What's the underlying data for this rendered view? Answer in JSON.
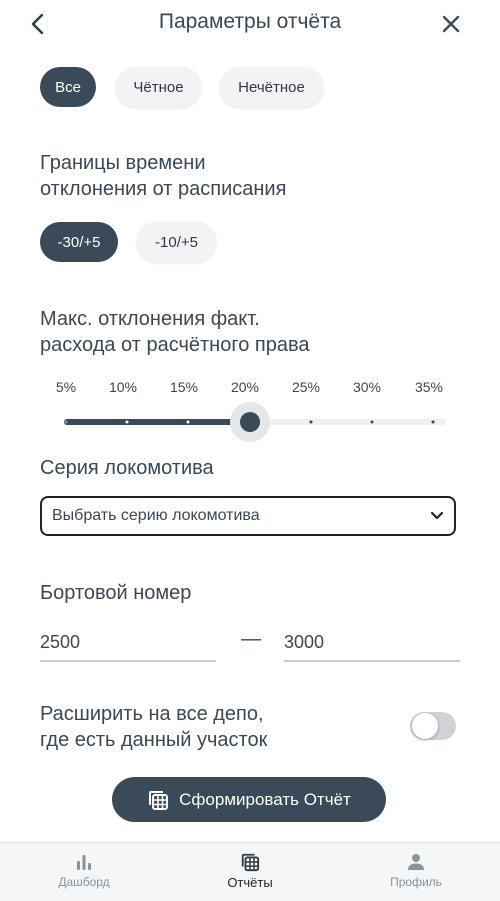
{
  "header": {
    "title": "Параметры отчёта"
  },
  "parity_filter": {
    "options": [
      "Все",
      "Чётное",
      "Нечётное"
    ],
    "selected": "Все"
  },
  "deviation_time": {
    "title_line1": "Границы времени",
    "title_line2": "отклонения от расписания",
    "options": [
      "-30/+5",
      "-10/+5"
    ],
    "selected": "-30/+5"
  },
  "max_deviation": {
    "title_line1": "Макс. отклонения факт.",
    "title_line2": "расхода от расчётного права",
    "ticks": [
      "5%",
      "10%",
      "15%",
      "20%",
      "25%",
      "30%",
      "35%"
    ],
    "selected_value": "20%"
  },
  "loco_series": {
    "title": "Серия локомотива",
    "placeholder": "Выбрать серию локомотива"
  },
  "board_number": {
    "title": "Бортовой номер",
    "from": "2500",
    "separator": "—",
    "to": "3000"
  },
  "expand_depots": {
    "label_line1": "Расширить на все депо,",
    "label_line2": "где есть данный участок",
    "enabled": false
  },
  "cta": {
    "label": "Сформировать Отчёт"
  },
  "bottom_nav": {
    "items": [
      {
        "label": "Дашборд",
        "icon": "bar-chart-icon"
      },
      {
        "label": "Отчёты",
        "icon": "report-grid-icon"
      },
      {
        "label": "Профиль",
        "icon": "person-icon"
      }
    ],
    "active": "Отчёты"
  },
  "colors": {
    "accent": "#3b4a58",
    "text": "#3b4753",
    "chip_bg": "#f3f3f5",
    "muted": "#8a929a"
  }
}
